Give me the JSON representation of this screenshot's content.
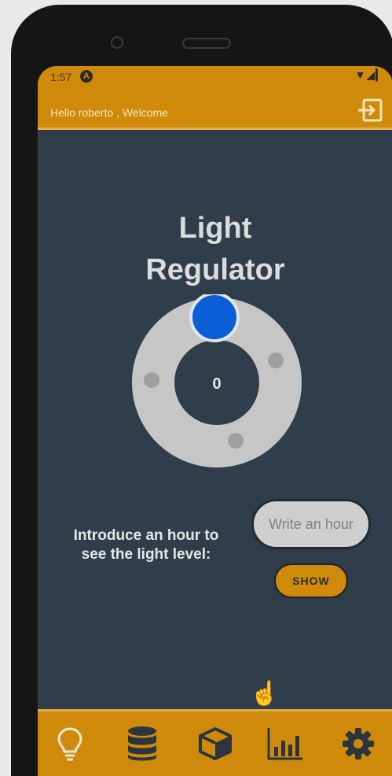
{
  "status_bar": {
    "time": "1:57",
    "badge": "A",
    "icons": "▼◢▎"
  },
  "header": {
    "welcome": "Hello roberto , Welcome",
    "logout_icon": "logout-icon"
  },
  "title": {
    "line1": "Light",
    "line2": "Regulator"
  },
  "dial": {
    "value": "0",
    "knob_color": "#0a5fd6",
    "ring_color": "#c6c6c6"
  },
  "hour_prompt": {
    "line1": "Introduce an hour to",
    "line2": "see the light level:"
  },
  "hour_input": {
    "value": "",
    "placeholder": "Write an hour"
  },
  "show_button": {
    "label": "SHOW"
  },
  "bottom_nav": {
    "items": [
      {
        "icon": "lightbulb-icon"
      },
      {
        "icon": "database-icon"
      },
      {
        "icon": "cube-icon"
      },
      {
        "icon": "bar-chart-icon"
      },
      {
        "icon": "gear-icon"
      }
    ]
  },
  "colors": {
    "accent": "#d08a09",
    "background": "#2f3e4a",
    "text": "#dcdcdc"
  }
}
